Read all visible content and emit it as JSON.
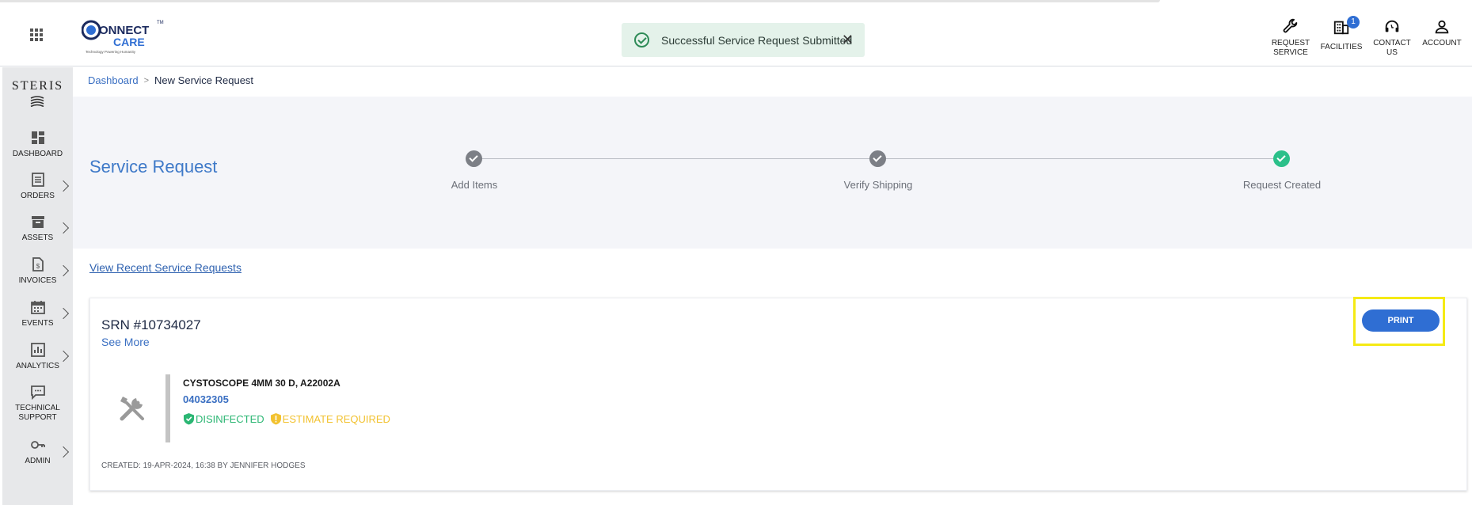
{
  "header": {
    "toast_text": "Successful Service Request Submitted",
    "nav": [
      {
        "label": "REQUEST\nSERVICE",
        "icon": "wrench-icon"
      },
      {
        "label": "FACILITIES",
        "icon": "building-icon",
        "badge": "1"
      },
      {
        "label": "CONTACT\nUS",
        "icon": "headset-icon"
      },
      {
        "label": "ACCOUNT",
        "icon": "user-icon"
      }
    ]
  },
  "sidebar": {
    "brand": "STERIS",
    "items": [
      {
        "label": "DASHBOARD",
        "icon": "dashboard-icon",
        "has_chevron": false
      },
      {
        "label": "ORDERS",
        "icon": "orders-icon",
        "has_chevron": true
      },
      {
        "label": "ASSETS",
        "icon": "assets-icon",
        "has_chevron": true
      },
      {
        "label": "INVOICES",
        "icon": "invoice-icon",
        "has_chevron": true
      },
      {
        "label": "EVENTS",
        "icon": "calendar-icon",
        "has_chevron": true
      },
      {
        "label": "ANALYTICS",
        "icon": "analytics-icon",
        "has_chevron": true
      },
      {
        "label": "TECHNICAL\nSUPPORT",
        "icon": "chat-icon",
        "has_chevron": false
      },
      {
        "label": "ADMIN",
        "icon": "key-icon",
        "has_chevron": true
      }
    ]
  },
  "breadcrumb": {
    "home": "Dashboard",
    "current": "New Service Request"
  },
  "page": {
    "title": "Service Request",
    "steps": [
      {
        "label": "Add Items",
        "status": "done",
        "color": "#7c7f86"
      },
      {
        "label": "Verify Shipping",
        "status": "done",
        "color": "#7c7f86"
      },
      {
        "label": "Request Created",
        "status": "current",
        "color": "#2bc08a"
      }
    ],
    "recent_link": "View Recent Service Requests"
  },
  "card": {
    "srn": "SRN #10734027",
    "see_more": "See More",
    "print_label": "PRINT",
    "item": {
      "name": "CYSTOSCOPE 4MM 30 D, A22002A",
      "number": "04032305",
      "tags": [
        {
          "label": "DISINFECTED",
          "color": "#2bb673",
          "icon": "shield-check-icon"
        },
        {
          "label": "ESTIMATE REQUIRED",
          "color": "#f2c230",
          "icon": "shield-alert-icon"
        }
      ]
    },
    "created": "CREATED: 19-APR-2024, 16:38 BY JENNIFER HODGES"
  },
  "colors": {
    "accent": "#2f6ed3",
    "highlight": "#f5ea14",
    "title_blue": "#3e79c8"
  }
}
